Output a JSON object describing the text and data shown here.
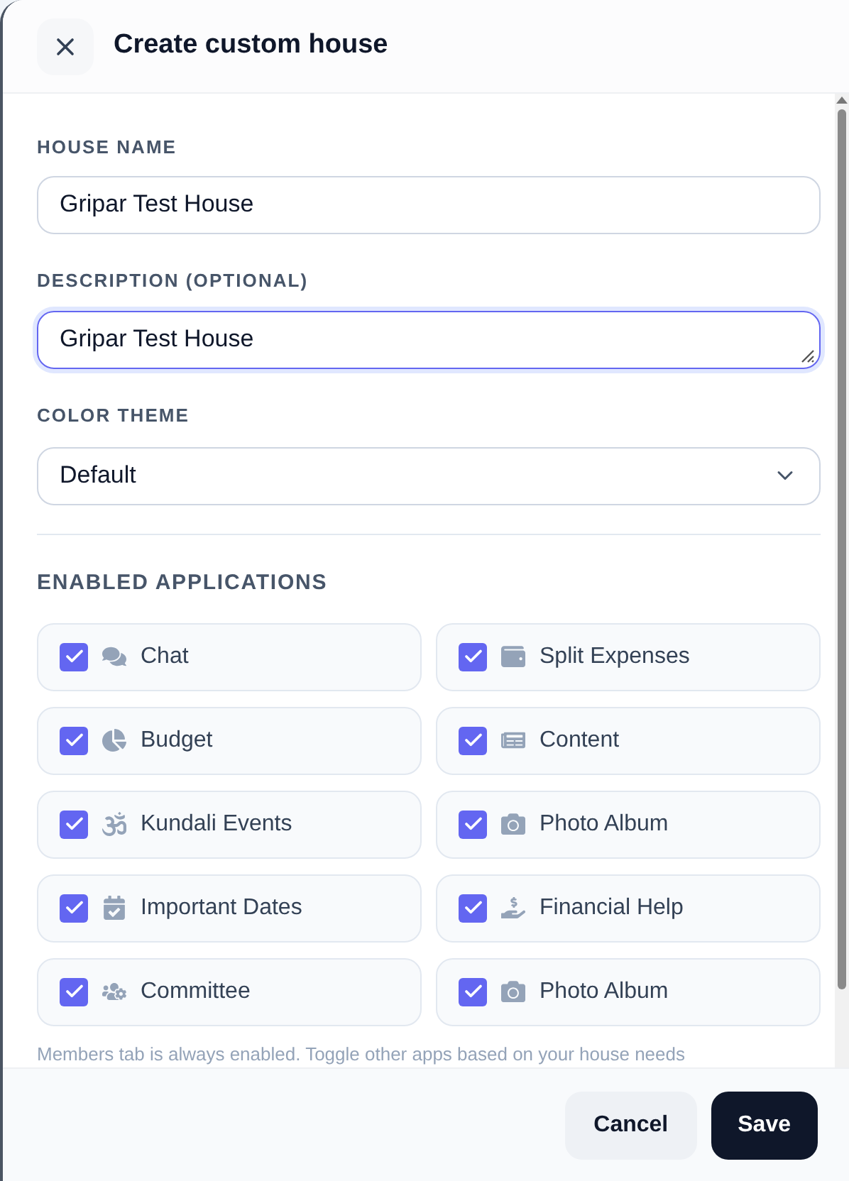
{
  "dialog": {
    "title": "Create custom house"
  },
  "house_name": {
    "label": "HOUSE NAME",
    "value": "Gripar Test House"
  },
  "description": {
    "label": "DESCRIPTION (OPTIONAL)",
    "value": "Gripar Test House",
    "focused": true
  },
  "color_theme": {
    "label": "COLOR THEME",
    "value": "Default"
  },
  "applications": {
    "label": "ENABLED APPLICATIONS",
    "items": [
      {
        "label": "Chat",
        "checked": true
      },
      {
        "label": "Split Expenses",
        "checked": true
      },
      {
        "label": "Budget",
        "checked": true
      },
      {
        "label": "Content",
        "checked": true
      },
      {
        "label": "Kundali Events",
        "checked": true
      },
      {
        "label": "Photo Album",
        "checked": true
      },
      {
        "label": "Important Dates",
        "checked": true
      },
      {
        "label": "Financial Help",
        "checked": true
      },
      {
        "label": "Committee",
        "checked": true
      },
      {
        "label": "Photo Album",
        "checked": true
      }
    ],
    "hint": "Members tab is always enabled. Toggle other apps based on your house needs"
  },
  "buttons": {
    "cancel": "Cancel",
    "save": "Save"
  }
}
